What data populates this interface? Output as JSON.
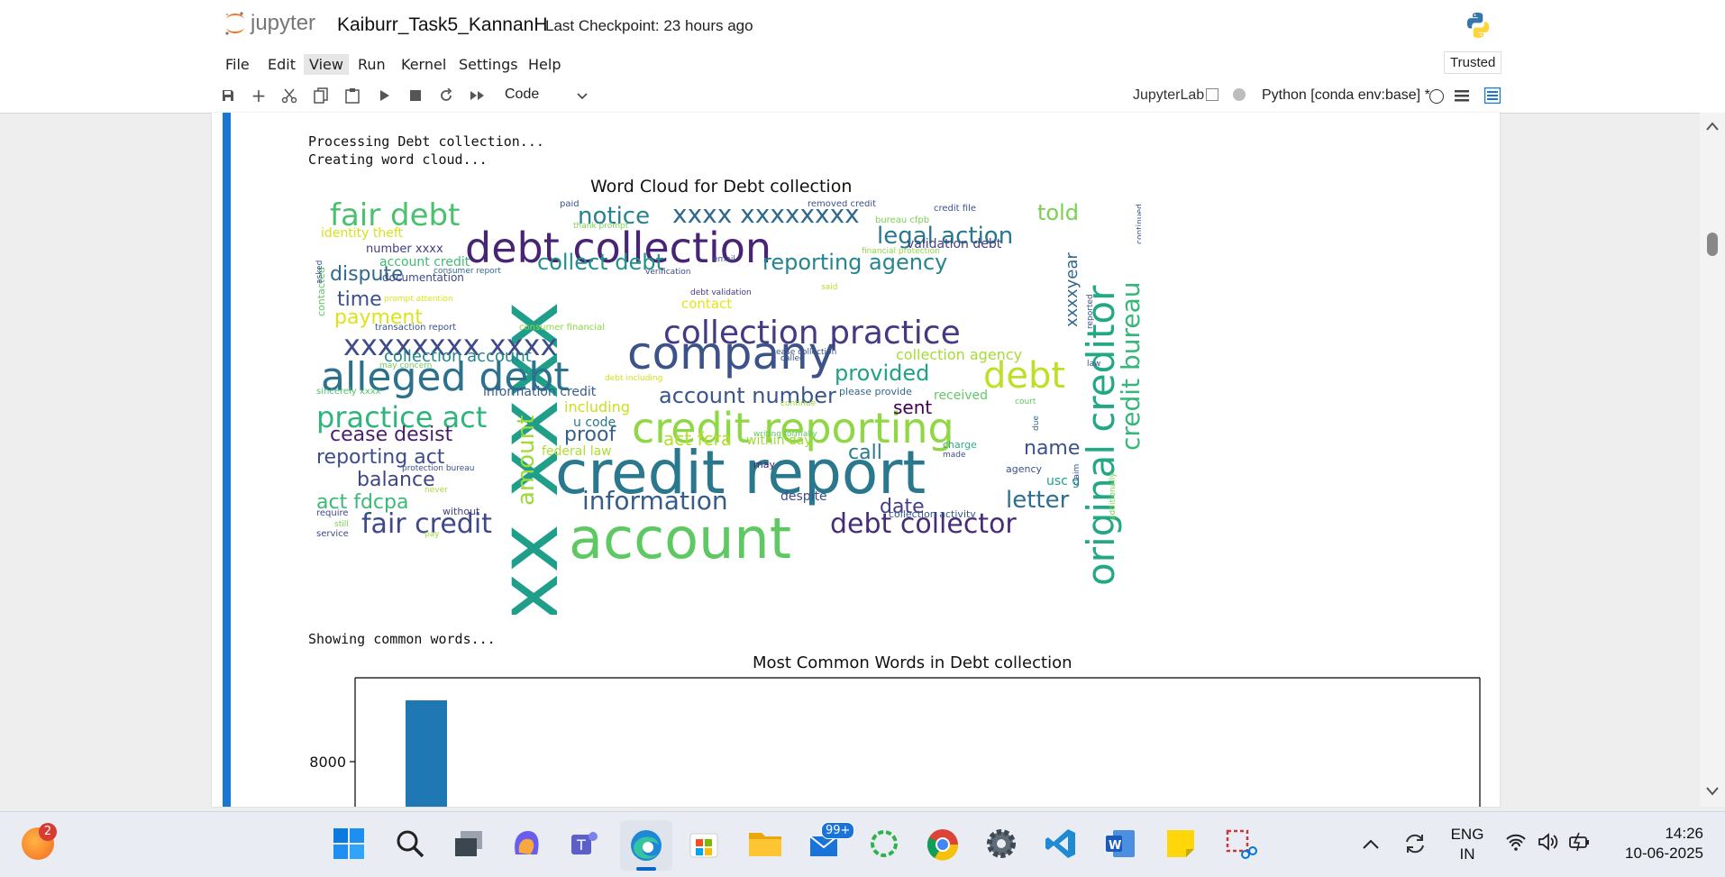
{
  "app": {
    "logo_text": "jupyter",
    "notebook_title": "Kaiburr_Task5_KannanH",
    "checkpoint": "Last Checkpoint: 23 hours ago",
    "trusted": "Trusted"
  },
  "menu": [
    "File",
    "Edit",
    "View",
    "Run",
    "Kernel",
    "Settings",
    "Help"
  ],
  "toolbar": {
    "cell_type": "Code",
    "jupyterlab_link": "JupyterLab",
    "kernel": "Python [conda env:base] *"
  },
  "output": {
    "line1": "Processing Debt collection...",
    "line2": "Creating word cloud...",
    "line3": "Showing common words..."
  },
  "wordcloud": {
    "title": "Word Cloud for Debt collection",
    "words": [
      {
        "t": "xxxx xxxx",
        "c": "#1f9e89",
        "v": 1
      },
      {
        "t": "debt collection",
        "c": "#482475",
        "v": 0
      },
      {
        "t": "credit report",
        "c": "#2a788e",
        "v": 0
      },
      {
        "t": "account",
        "c": "#5ec962",
        "v": 0
      },
      {
        "t": "credit reporting",
        "c": "#8fd744",
        "v": 0
      },
      {
        "t": "original creditor",
        "c": "#22a884",
        "v": 1
      },
      {
        "t": "company",
        "c": "#3b528b",
        "v": 0
      },
      {
        "t": "alleged debt",
        "c": "#2c728e",
        "v": 0
      },
      {
        "t": "collection practice",
        "c": "#443a83",
        "v": 0
      },
      {
        "t": "fair debt",
        "c": "#4ac16d",
        "v": 0
      },
      {
        "t": "debt",
        "c": "#bddf26",
        "v": 0
      },
      {
        "t": "xxxxxxxx xxxx",
        "c": "#3e4a89",
        "v": 0
      },
      {
        "t": "credit bureau",
        "c": "#35b779",
        "v": 1
      },
      {
        "t": "practice act",
        "c": "#2fb47c",
        "v": 0
      },
      {
        "t": "xxxx xxxxxxxx",
        "c": "#31688e",
        "v": 0
      },
      {
        "t": "notice",
        "c": "#26828e",
        "v": 0
      },
      {
        "t": "legal action",
        "c": "#2a788e",
        "v": 0
      },
      {
        "t": "reporting agency",
        "c": "#25858e",
        "v": 0
      },
      {
        "t": "collect debt",
        "c": "#21918c",
        "v": 0
      },
      {
        "t": "debt collector",
        "c": "#472c7a",
        "v": 0
      },
      {
        "t": "information",
        "c": "#365c8d",
        "v": 0
      },
      {
        "t": "fair credit",
        "c": "#3f4889",
        "v": 0
      },
      {
        "t": "account number",
        "c": "#3a548c",
        "v": 0
      },
      {
        "t": "provided",
        "c": "#1fa187",
        "v": 0
      },
      {
        "t": "told",
        "c": "#7ad151",
        "v": 0
      },
      {
        "t": "amount",
        "c": "#9fda3a",
        "v": 1
      },
      {
        "t": "cease desist",
        "c": "#481f70",
        "v": 0
      },
      {
        "t": "reporting act",
        "c": "#3e4c8a",
        "v": 0
      },
      {
        "t": "dispute",
        "c": "#31688e",
        "v": 0
      },
      {
        "t": "act fdcpa",
        "c": "#3aba76",
        "v": 0
      },
      {
        "t": "balance",
        "c": "#3f4788",
        "v": 0
      },
      {
        "t": "time",
        "c": "#3b518b",
        "v": 0
      },
      {
        "t": "payment",
        "c": "#dde318",
        "v": 0
      },
      {
        "t": "letter",
        "c": "#2e6e8e",
        "v": 0
      },
      {
        "t": "date",
        "c": "#433e85",
        "v": 0
      },
      {
        "t": "name",
        "c": "#3b528b",
        "v": 0
      },
      {
        "t": "call",
        "c": "#287c8e",
        "v": 0
      },
      {
        "t": "proof",
        "c": "#355f8d",
        "v": 0
      },
      {
        "t": "sent",
        "c": "#440154",
        "v": 0
      },
      {
        "t": "act fcra",
        "c": "#b5de2b",
        "v": 0
      },
      {
        "t": "collection account",
        "c": "#24868e",
        "v": 0
      },
      {
        "t": "collection agency",
        "c": "#a5db36",
        "v": 0
      },
      {
        "t": "identity theft",
        "c": "#d8e219",
        "v": 0
      },
      {
        "t": "validation debt",
        "c": "#424086",
        "v": 0
      },
      {
        "t": "xxxxyear",
        "c": "#31688e",
        "v": 1
      },
      {
        "t": "number xxxx",
        "c": "#433e85",
        "v": 0
      },
      {
        "t": "account credit",
        "c": "#3fbc73",
        "v": 0
      },
      {
        "t": "within day",
        "c": "#a2da37",
        "v": 0
      },
      {
        "t": "information credit",
        "c": "#375b8d",
        "v": 0
      },
      {
        "t": "including",
        "c": "#c8e020",
        "v": 0
      },
      {
        "t": "u code",
        "c": "#2a788e",
        "v": 0
      },
      {
        "t": "federal law",
        "c": "#b0dd2f",
        "v": 0
      },
      {
        "t": "despite",
        "c": "#3d4e8a",
        "v": 0
      },
      {
        "t": "received",
        "c": "#60ca60",
        "v": 0
      },
      {
        "t": "contact",
        "c": "#e5e419",
        "v": 0
      },
      {
        "t": "documentation",
        "c": "#3e4989",
        "v": 0
      },
      {
        "t": "contacted",
        "c": "#5cc863",
        "v": 1
      },
      {
        "t": "paid",
        "c": "#3b528b",
        "v": 0
      },
      {
        "t": "usc g",
        "c": "#1f9e89",
        "v": 0
      },
      {
        "t": "please provide",
        "c": "#31688e",
        "v": 0
      },
      {
        "t": "debt validation",
        "c": "#443983",
        "v": 0
      },
      {
        "t": "charge",
        "c": "#29af7f",
        "v": 0
      },
      {
        "t": "agency",
        "c": "#3b528b",
        "v": 0
      },
      {
        "t": "writing formally",
        "c": "#5ec962",
        "v": 0
      },
      {
        "t": "transaction report",
        "c": "#3b528b",
        "v": 0
      },
      {
        "t": "consumer financial",
        "c": "#8fd744",
        "v": 0
      },
      {
        "t": "collection activity",
        "c": "#39568c",
        "v": 0
      },
      {
        "t": "sincerely xxxx",
        "c": "#50c46a",
        "v": 0
      },
      {
        "t": "debt including",
        "c": "#d2e21b",
        "v": 0
      },
      {
        "t": "cease collection",
        "c": "#3b528b",
        "v": 0
      },
      {
        "t": "may concern",
        "c": "#6ece58",
        "v": 0
      },
      {
        "t": "protection bureau",
        "c": "#3b528b",
        "v": 0
      },
      {
        "t": "without",
        "c": "#404387",
        "v": 0
      },
      {
        "t": "require",
        "c": "#3e4a89",
        "v": 0
      },
      {
        "t": "still",
        "c": "#7ad151",
        "v": 0
      },
      {
        "t": "service",
        "c": "#3e4a89",
        "v": 0
      },
      {
        "t": "pay",
        "c": "#9fda3a",
        "v": 0
      },
      {
        "t": "never",
        "c": "#a8db34",
        "v": 0
      },
      {
        "t": "may",
        "c": "#482878",
        "v": 0
      },
      {
        "t": "made",
        "c": "#3b528b",
        "v": 0
      },
      {
        "t": "continue",
        "c": "#9fda3a",
        "v": 0
      },
      {
        "t": "court",
        "c": "#5ec962",
        "v": 0
      },
      {
        "t": "law",
        "c": "#3b528b",
        "v": 0
      },
      {
        "t": "called",
        "c": "#3b528b",
        "v": 0
      },
      {
        "t": "said",
        "c": "#bddf26",
        "v": 0
      },
      {
        "t": "email",
        "c": "#3b528b",
        "v": 0
      },
      {
        "t": "verification",
        "c": "#3e4989",
        "v": 0
      },
      {
        "t": "consumer report",
        "c": "#31688e",
        "v": 0
      },
      {
        "t": "prompt attention",
        "c": "#dde318",
        "v": 0
      },
      {
        "t": "thank prompt",
        "c": "#7ad151",
        "v": 0
      },
      {
        "t": "removed credit",
        "c": "#3b528b",
        "v": 0
      },
      {
        "t": "credit file",
        "c": "#3b528b",
        "v": 0
      },
      {
        "t": "bureau cfpb",
        "c": "#7ad151",
        "v": 0
      },
      {
        "t": "financial protection",
        "c": "#8fd744",
        "v": 0
      },
      {
        "t": "asked",
        "c": "#3b528b",
        "v": 1
      },
      {
        "t": "continued",
        "c": "#3b528b",
        "v": 1
      },
      {
        "t": "reported",
        "c": "#3b528b",
        "v": 1
      },
      {
        "t": "due",
        "c": "#31688e",
        "v": 1
      },
      {
        "t": "claim",
        "c": "#3b528b",
        "v": 1
      },
      {
        "t": "additionally",
        "c": "#7ad151",
        "v": 1
      }
    ]
  },
  "chart_data": {
    "type": "bar",
    "title": "Most Common Words in Debt collection",
    "ytick_labels": [
      "8000"
    ],
    "series": [
      {
        "values": [
          9200
        ]
      }
    ],
    "ylim_visible": [
      7600,
      9700
    ]
  },
  "taskbar": {
    "badge_count": "2",
    "mail_badge": "99+",
    "lang1": "ENG",
    "lang2": "IN",
    "time": "14:26",
    "date": "10-06-2025"
  }
}
